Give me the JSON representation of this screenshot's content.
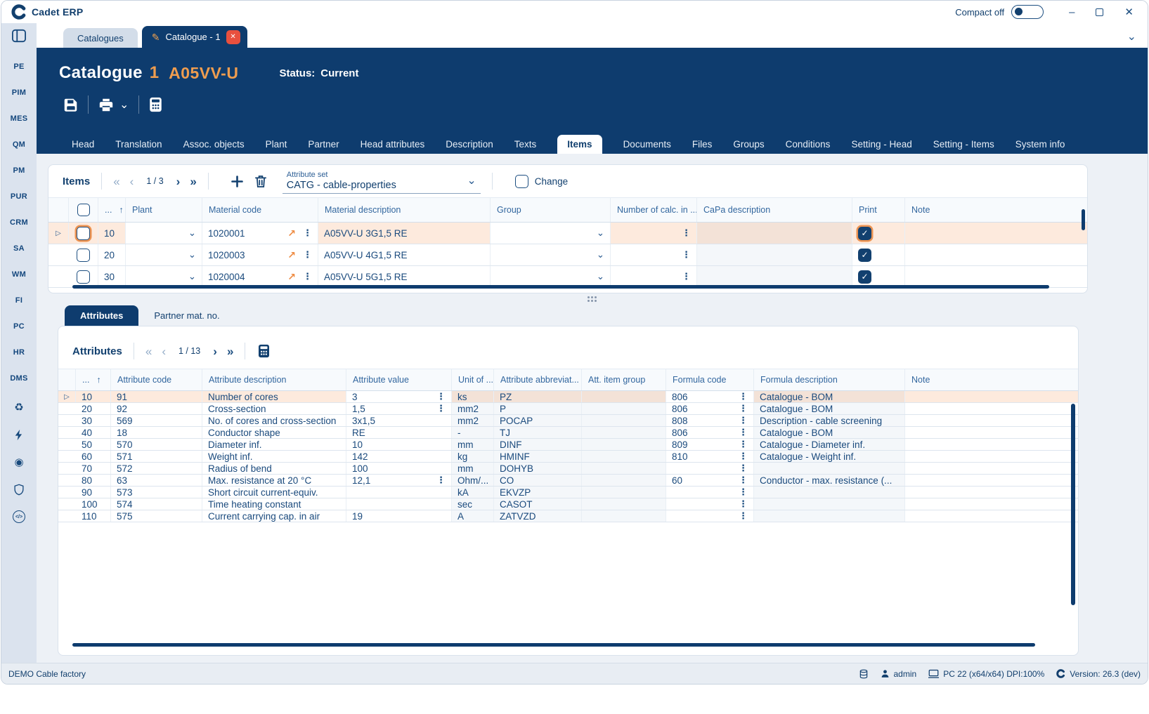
{
  "app": {
    "logo_text": "Cadet ERP",
    "compact_label": "Compact off"
  },
  "window_tabs": [
    {
      "label": "Catalogues"
    },
    {
      "label": "Catalogue - 1"
    }
  ],
  "header": {
    "title": "Catalogue",
    "number": "1",
    "code": "A05VV-U",
    "status_label": "Status:",
    "status_value": "Current"
  },
  "nav_tabs": [
    {
      "label": "Head"
    },
    {
      "label": "Translation"
    },
    {
      "label": "Assoc. objects"
    },
    {
      "label": "Plant"
    },
    {
      "label": "Partner"
    },
    {
      "label": "Head attributes"
    },
    {
      "label": "Description"
    },
    {
      "label": "Texts"
    },
    {
      "label": "Items",
      "active": true
    },
    {
      "label": "Documents"
    },
    {
      "label": "Files"
    },
    {
      "label": "Groups"
    },
    {
      "label": "Conditions"
    },
    {
      "label": "Setting - Head"
    },
    {
      "label": "Setting - Items"
    },
    {
      "label": "System info"
    }
  ],
  "sidebar": {
    "modules": [
      {
        "label": "PE"
      },
      {
        "label": "PIM"
      },
      {
        "label": "MES"
      },
      {
        "label": "QM"
      },
      {
        "label": "PM"
      },
      {
        "label": "PUR"
      },
      {
        "label": "CRM"
      },
      {
        "label": "SA"
      },
      {
        "label": "WM"
      },
      {
        "label": "FI"
      },
      {
        "label": "PC"
      },
      {
        "label": "HR"
      },
      {
        "label": "DMS"
      }
    ],
    "code_icon_text": "</>"
  },
  "icons": {
    "first": "«",
    "prev": "‹",
    "next": "›",
    "last": "»",
    "kebab": "⋮",
    "link_arrow": "↗",
    "chevron_down": "⌄",
    "expander": "▷",
    "sort_asc": "↑",
    "ellipsis": "...",
    "check": "✓",
    "close": "✕",
    "minimize": "–",
    "pencil": "✎",
    "target": "◉",
    "recycle": "♻",
    "plus": "+"
  },
  "items_panel": {
    "title": "Items",
    "page": "1 / 3",
    "attribute_set_label": "Attribute set",
    "attribute_set_value": "CATG - cable-properties",
    "change_label": "Change",
    "columns": {
      "plant": "Plant",
      "material_code": "Material code",
      "material_description": "Material description",
      "group": "Group",
      "num_calc": "Number of calc. in ...",
      "capa": "CaPa description",
      "print": "Print",
      "note": "Note"
    },
    "rows": [
      {
        "num": "10",
        "plant": "",
        "material_code": "1020001",
        "material_description": "A05VV-U 3G1,5 RE",
        "group": "",
        "num_calc": "",
        "capa": "",
        "print": true,
        "note": "",
        "selected": true
      },
      {
        "num": "20",
        "plant": "",
        "material_code": "1020003",
        "material_description": "A05VV-U 4G1,5 RE",
        "group": "",
        "num_calc": "",
        "capa": "",
        "print": true,
        "note": ""
      },
      {
        "num": "30",
        "plant": "",
        "material_code": "1020004",
        "material_description": "A05VV-U 5G1,5 RE",
        "group": "",
        "num_calc": "",
        "capa": "",
        "print": true,
        "note": ""
      }
    ]
  },
  "detail_tabs": {
    "attributes": "Attributes",
    "partner_mat_no": "Partner mat. no."
  },
  "attributes_panel": {
    "title": "Attributes",
    "page": "1 / 13",
    "columns": {
      "code": "Attribute code",
      "description": "Attribute description",
      "value": "Attribute value",
      "unit": "Unit of ...",
      "abbrev": "Attribute abbreviat...",
      "item_group": "Att. item group",
      "formula_code": "Formula code",
      "formula_description": "Formula description",
      "note": "Note"
    },
    "rows": [
      {
        "num": "10",
        "code": "91",
        "description": "Number of cores",
        "value": "3",
        "value_menu": true,
        "unit": "ks",
        "abbrev": "PZ",
        "item_group": "",
        "formula_code": "806",
        "formula_menu": true,
        "formula_description": "Catalogue - BOM",
        "note": "",
        "selected": true
      },
      {
        "num": "20",
        "code": "92",
        "description": "Cross-section",
        "value": "1,5",
        "value_menu": true,
        "unit": "mm2",
        "abbrev": "P",
        "item_group": "",
        "formula_code": "806",
        "formula_menu": true,
        "formula_description": "Catalogue - BOM",
        "note": ""
      },
      {
        "num": "30",
        "code": "569",
        "description": "No. of cores and cross-section",
        "value": "3x1,5",
        "value_menu": false,
        "unit": "mm2",
        "abbrev": "POCAP",
        "item_group": "",
        "formula_code": "808",
        "formula_menu": true,
        "formula_description": "Description - cable screening",
        "note": ""
      },
      {
        "num": "40",
        "code": "18",
        "description": "Conductor shape",
        "value": "RE",
        "value_menu": false,
        "unit": "-",
        "abbrev": "TJ",
        "item_group": "",
        "formula_code": "806",
        "formula_menu": true,
        "formula_description": "Catalogue - BOM",
        "note": ""
      },
      {
        "num": "50",
        "code": "570",
        "description": "Diameter inf.",
        "value": "10",
        "value_menu": false,
        "unit": "mm",
        "abbrev": "DINF",
        "item_group": "",
        "formula_code": "809",
        "formula_menu": true,
        "formula_description": "Catalogue - Diameter inf.",
        "note": ""
      },
      {
        "num": "60",
        "code": "571",
        "description": "Weight inf.",
        "value": "142",
        "value_menu": false,
        "unit": "kg",
        "abbrev": "HMINF",
        "item_group": "",
        "formula_code": "810",
        "formula_menu": true,
        "formula_description": "Catalogue - Weight inf.",
        "note": ""
      },
      {
        "num": "70",
        "code": "572",
        "description": "Radius of bend",
        "value": "100",
        "value_menu": false,
        "unit": "mm",
        "abbrev": "DOHYB",
        "item_group": "",
        "formula_code": "",
        "formula_menu": true,
        "formula_description": "",
        "note": ""
      },
      {
        "num": "80",
        "code": "63",
        "description": "Max. resistance at 20 °C",
        "value": "12,1",
        "value_menu": true,
        "unit": "Ohm/...",
        "abbrev": "CO",
        "item_group": "",
        "formula_code": "60",
        "formula_menu": true,
        "formula_description": "Conductor - max. resistance (...",
        "note": ""
      },
      {
        "num": "90",
        "code": "573",
        "description": "Short circuit current-equiv.",
        "value": "",
        "value_menu": false,
        "unit": "kA",
        "abbrev": "EKVZP",
        "item_group": "",
        "formula_code": "",
        "formula_menu": true,
        "formula_description": "",
        "note": ""
      },
      {
        "num": "100",
        "code": "574",
        "description": "Time heating constant",
        "value": "",
        "value_menu": false,
        "unit": "sec",
        "abbrev": "CASOT",
        "item_group": "",
        "formula_code": "",
        "formula_menu": true,
        "formula_description": "",
        "note": ""
      },
      {
        "num": "110",
        "code": "575",
        "description": "Current carrying cap. in air",
        "value": "19",
        "value_menu": false,
        "unit": "A",
        "abbrev": "ZATVZD",
        "item_group": "",
        "formula_code": "",
        "formula_menu": true,
        "formula_description": "",
        "note": ""
      }
    ]
  },
  "status_bar": {
    "company": "DEMO Cable factory",
    "user": "admin",
    "machine": "PC 22 (x64/x64) DPI:100%",
    "version": "Version: 26.3 (dev)"
  }
}
